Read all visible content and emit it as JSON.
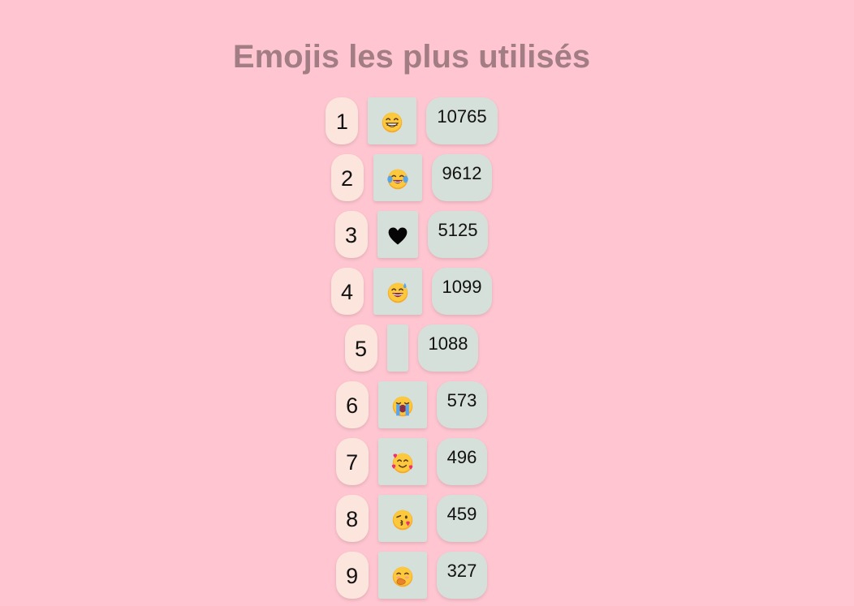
{
  "page": {
    "title": "Emojis les plus utilisés"
  },
  "colors": {
    "background": "#ffc6d1",
    "title": "#a27d84",
    "rank_bg": "#fce5dc",
    "card_bg": "#d6e0da"
  },
  "emoji_list": [
    {
      "rank": "1",
      "emoji_icon": "beaming-face-with-smiling-eyes-icon",
      "count": "10765"
    },
    {
      "rank": "2",
      "emoji_icon": "face-with-tears-of-joy-icon",
      "count": "9612"
    },
    {
      "rank": "3",
      "emoji_icon": "black-heart-icon",
      "count": "5125"
    },
    {
      "rank": "4",
      "emoji_icon": "grinning-face-with-sweat-icon",
      "count": "1099"
    },
    {
      "rank": "5",
      "emoji_icon": "empty",
      "count": "1088"
    },
    {
      "rank": "6",
      "emoji_icon": "loudly-crying-face-icon",
      "count": "573"
    },
    {
      "rank": "7",
      "emoji_icon": "smiling-face-with-hearts-icon",
      "count": "496"
    },
    {
      "rank": "8",
      "emoji_icon": "face-blowing-a-kiss-icon",
      "count": "459"
    },
    {
      "rank": "9",
      "emoji_icon": "face-with-hand-over-mouth-icon",
      "count": "327"
    }
  ]
}
